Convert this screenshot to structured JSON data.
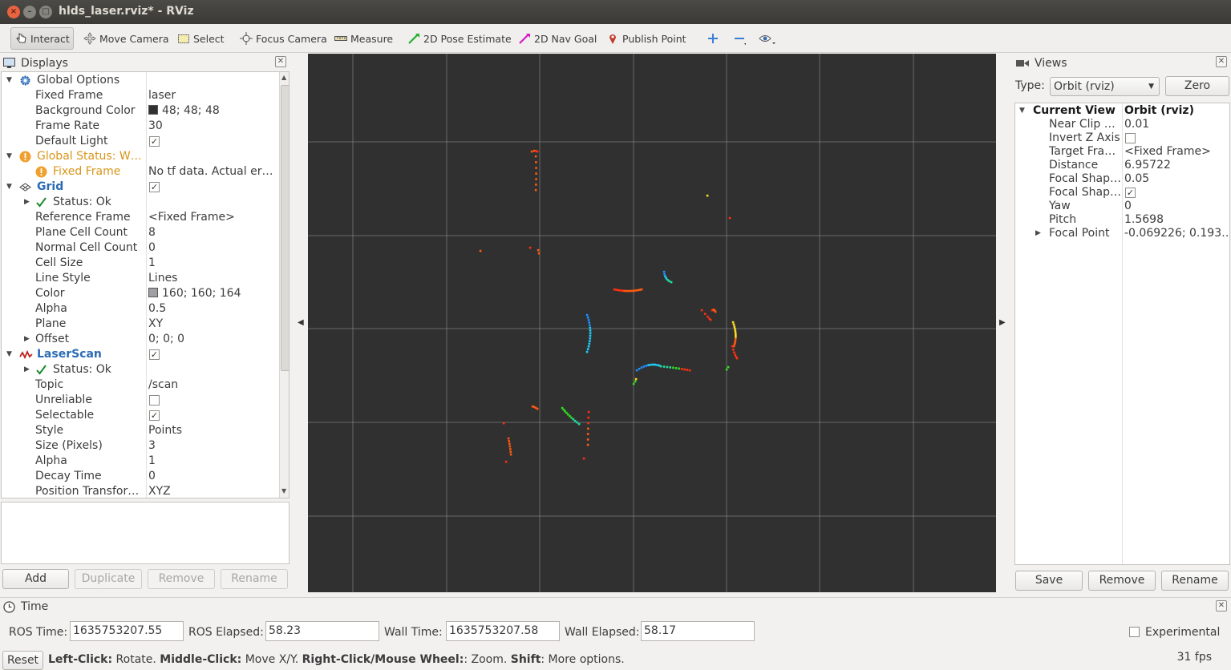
{
  "window": {
    "title": "hlds_laser.rviz* - RViz",
    "close_glyph": "×",
    "min_glyph": "–",
    "max_glyph": "□"
  },
  "toolbar": {
    "tools": [
      {
        "label": "Interact",
        "icon": "hand-pointer-icon",
        "active": true
      },
      {
        "label": "Move Camera",
        "icon": "move-arrows-icon"
      },
      {
        "label": "Select",
        "icon": "select-box-icon"
      },
      {
        "label": "Focus Camera",
        "icon": "crosshair-icon"
      },
      {
        "label": "Measure",
        "icon": "ruler-icon"
      },
      {
        "label": "2D Pose Estimate",
        "icon": "green-arrow-icon"
      },
      {
        "label": "2D Nav Goal",
        "icon": "magenta-arrow-icon"
      },
      {
        "label": "Publish Point",
        "icon": "map-pin-icon"
      }
    ],
    "extra_icons": [
      "plus-icon",
      "minus-icon",
      "eye-icon"
    ]
  },
  "displays": {
    "title": "Displays",
    "rows": [
      {
        "label": "Global Options",
        "value": "",
        "indent": 0,
        "arrow": "▼",
        "icon": "gear-icon"
      },
      {
        "label": "Fixed Frame",
        "value": "laser",
        "indent": 1
      },
      {
        "label": "Background Color",
        "value": "48; 48; 48",
        "indent": 1,
        "swatch": "#303030"
      },
      {
        "label": "Frame Rate",
        "value": "30",
        "indent": 1
      },
      {
        "label": "Default Light",
        "value": "",
        "indent": 1,
        "check": true
      },
      {
        "label": "Global Status: W…",
        "value": "",
        "indent": 0,
        "arrow": "▼",
        "icon": "warning-icon",
        "warn": true
      },
      {
        "label": "Fixed Frame",
        "value": "No tf data.  Actual er…",
        "indent": 1,
        "icon": "warning-icon",
        "warn": true
      },
      {
        "label": "Grid",
        "value": "",
        "indent": 0,
        "arrow": "▼",
        "icon": "grid-icon",
        "check": true,
        "blue": true
      },
      {
        "label": "Status: Ok",
        "value": "",
        "indent": 1,
        "arrow": "▶",
        "icon": "checkmark-icon"
      },
      {
        "label": "Reference Frame",
        "value": "<Fixed Frame>",
        "indent": 1
      },
      {
        "label": "Plane Cell Count",
        "value": "8",
        "indent": 1
      },
      {
        "label": "Normal Cell Count",
        "value": "0",
        "indent": 1
      },
      {
        "label": "Cell Size",
        "value": "1",
        "indent": 1
      },
      {
        "label": "Line Style",
        "value": "Lines",
        "indent": 1
      },
      {
        "label": "Color",
        "value": "160; 160; 164",
        "indent": 1,
        "swatch": "#a0a0a4"
      },
      {
        "label": "Alpha",
        "value": "0.5",
        "indent": 1
      },
      {
        "label": "Plane",
        "value": "XY",
        "indent": 1
      },
      {
        "label": "Offset",
        "value": "0; 0; 0",
        "indent": 1,
        "arrow": "▶"
      },
      {
        "label": "LaserScan",
        "value": "",
        "indent": 0,
        "arrow": "▼",
        "icon": "laser-wave-icon",
        "check": true,
        "blue": true
      },
      {
        "label": "Status: Ok",
        "value": "",
        "indent": 1,
        "arrow": "▶",
        "icon": "checkmark-icon"
      },
      {
        "label": "Topic",
        "value": "/scan",
        "indent": 1
      },
      {
        "label": "Unreliable",
        "value": "",
        "indent": 1,
        "check": false
      },
      {
        "label": "Selectable",
        "value": "",
        "indent": 1,
        "check": true
      },
      {
        "label": "Style",
        "value": "Points",
        "indent": 1
      },
      {
        "label": "Size (Pixels)",
        "value": "3",
        "indent": 1
      },
      {
        "label": "Alpha",
        "value": "1",
        "indent": 1
      },
      {
        "label": "Decay Time",
        "value": "0",
        "indent": 1
      },
      {
        "label": "Position Transfor…",
        "value": "XYZ",
        "indent": 1
      }
    ],
    "buttons": {
      "add": "Add",
      "duplicate": "Duplicate",
      "remove": "Remove",
      "rename": "Rename"
    }
  },
  "views": {
    "title": "Views",
    "type_label": "Type:",
    "type_value": "Orbit (rviz)",
    "zero_label": "Zero",
    "rows": [
      {
        "label": "Current View",
        "value": "Orbit (rviz)",
        "header": true
      },
      {
        "label": "Near Clip …",
        "value": "0.01"
      },
      {
        "label": "Invert Z Axis",
        "value": "",
        "check": false
      },
      {
        "label": "Target Fra…",
        "value": "<Fixed Frame>"
      },
      {
        "label": "Distance",
        "value": "6.95722"
      },
      {
        "label": "Focal Shap…",
        "value": "0.05"
      },
      {
        "label": "Focal Shap…",
        "value": "",
        "check": true
      },
      {
        "label": "Yaw",
        "value": "0"
      },
      {
        "label": "Pitch",
        "value": "1.5698"
      },
      {
        "label": "Focal Point",
        "value": "-0.069226; 0.193…",
        "arrow": true
      }
    ],
    "buttons": {
      "save": "Save",
      "remove": "Remove",
      "rename": "Rename"
    }
  },
  "time": {
    "title": "Time",
    "ros_time_label": "ROS Time:",
    "ros_time": "1635753207.55",
    "ros_elapsed_label": "ROS Elapsed:",
    "ros_elapsed": "58.23",
    "wall_time_label": "Wall Time:",
    "wall_time": "1635753207.58",
    "wall_elapsed_label": "Wall Elapsed:",
    "wall_elapsed": "58.17",
    "experimental_label": "Experimental",
    "reset_label": "Reset",
    "help": [
      {
        "b": "Left-Click:",
        "t": " Rotate. "
      },
      {
        "b": "Middle-Click:",
        "t": " Move X/Y. "
      },
      {
        "b": "Right-Click/Mouse Wheel:",
        "t": ": Zoom. "
      },
      {
        "b": "Shift",
        "t": ": More options."
      }
    ],
    "fps": "31 fps"
  },
  "colors": {
    "background": "#303030",
    "grid": "#a0a0a4",
    "warning": "#d8961a",
    "blue_label": "#2a6bb4"
  }
}
